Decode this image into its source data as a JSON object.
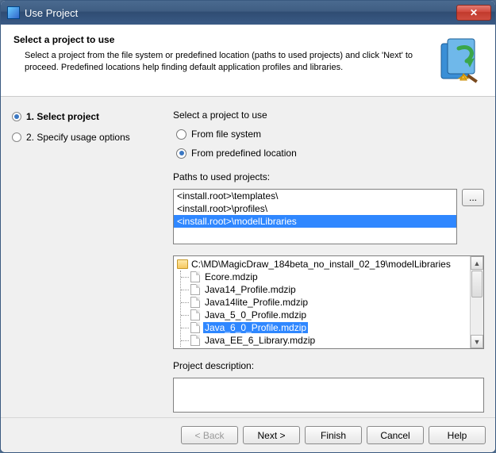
{
  "window": {
    "title": "Use Project",
    "close_glyph": "✕"
  },
  "header": {
    "title": "Select a project to use",
    "desc": "Select a project from the file system or predefined location (paths to used projects) and click 'Next' to proceed. Predefined locations help finding default application profiles and libraries."
  },
  "steps": {
    "items": [
      {
        "label": "1. Select project",
        "active": true
      },
      {
        "label": "2. Specify usage options",
        "active": false
      }
    ]
  },
  "form": {
    "select_label": "Select a project to use",
    "radio_filesystem": "From file system",
    "radio_predefined": "From predefined location",
    "paths_label": "Paths to used projects:",
    "browse_label": "...",
    "desc_label": "Project description:",
    "desc_value": ""
  },
  "paths": {
    "rows": [
      {
        "text": "<install.root>\\templates\\",
        "selected": false
      },
      {
        "text": "<install.root>\\profiles\\",
        "selected": false
      },
      {
        "text": "<install.root>\\modelLibraries",
        "selected": true
      }
    ]
  },
  "tree": {
    "root": "C:\\MD\\MagicDraw_184beta_no_install_02_19\\modelLibraries",
    "items": [
      {
        "name": "Ecore.mdzip",
        "selected": false
      },
      {
        "name": "Java14_Profile.mdzip",
        "selected": false
      },
      {
        "name": "Java14lite_Profile.mdzip",
        "selected": false
      },
      {
        "name": "Java_5_0_Profile.mdzip",
        "selected": false
      },
      {
        "name": "Java_6_0_Profile.mdzip",
        "selected": true
      },
      {
        "name": "Java_EE_6_Library.mdzip",
        "selected": false
      }
    ]
  },
  "footer": {
    "back": "< Back",
    "next": "Next >",
    "finish": "Finish",
    "cancel": "Cancel",
    "help": "Help"
  }
}
